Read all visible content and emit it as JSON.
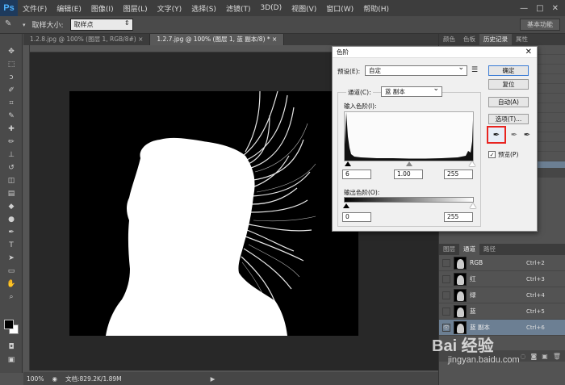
{
  "app": {
    "logo": "Ps"
  },
  "menu": [
    "文件(F)",
    "编辑(E)",
    "图像(I)",
    "图层(L)",
    "文字(Y)",
    "选择(S)",
    "滤镜(T)",
    "3D(D)",
    "视图(V)",
    "窗口(W)",
    "帮助(H)"
  ],
  "window_controls": [
    "—",
    "□",
    "✕"
  ],
  "options": {
    "sample_size_label": "取样大小:",
    "sample_size_value": "取样点",
    "workspace": "基本功能"
  },
  "tabs": [
    "1.2.8.jpg @ 100% (图层 1, RGB/8#) ×",
    "1.2.7.jpg @ 100% (图层 1, 蓝 副本/8) * ×"
  ],
  "status": {
    "zoom": "100%",
    "doc": "文档:829.2K/1.89M"
  },
  "panels": {
    "top_tabs": [
      "颜色",
      "色板",
      "历史记录",
      "属性"
    ],
    "channel_tabs": [
      "图层",
      "通道",
      "路径"
    ],
    "channels": [
      {
        "name": "RGB",
        "shortcut": "Ctrl+2",
        "selected": false
      },
      {
        "name": "红",
        "shortcut": "Ctrl+3",
        "selected": false
      },
      {
        "name": "绿",
        "shortcut": "Ctrl+4",
        "selected": false
      },
      {
        "name": "蓝",
        "shortcut": "Ctrl+5",
        "selected": false
      },
      {
        "name": "蓝 副本",
        "shortcut": "Ctrl+6",
        "selected": true
      }
    ]
  },
  "dialog": {
    "title": "色阶",
    "preset_label": "预设(E):",
    "preset_value": "自定",
    "channel_label": "通道(C):",
    "channel_value": "蓝 副本",
    "input_label": "输入色阶(I):",
    "input_black": "6",
    "input_gamma": "1.00",
    "input_white": "255",
    "output_label": "输出色阶(O):",
    "output_black": "0",
    "output_white": "255",
    "buttons": [
      "确定",
      "复位",
      "自动(A)",
      "选项(T)..."
    ],
    "preview_label": "预览(P)",
    "preview_checked": true
  },
  "watermark": {
    "main": "Bai 经验",
    "sub": "jingyan.baidu.com"
  }
}
